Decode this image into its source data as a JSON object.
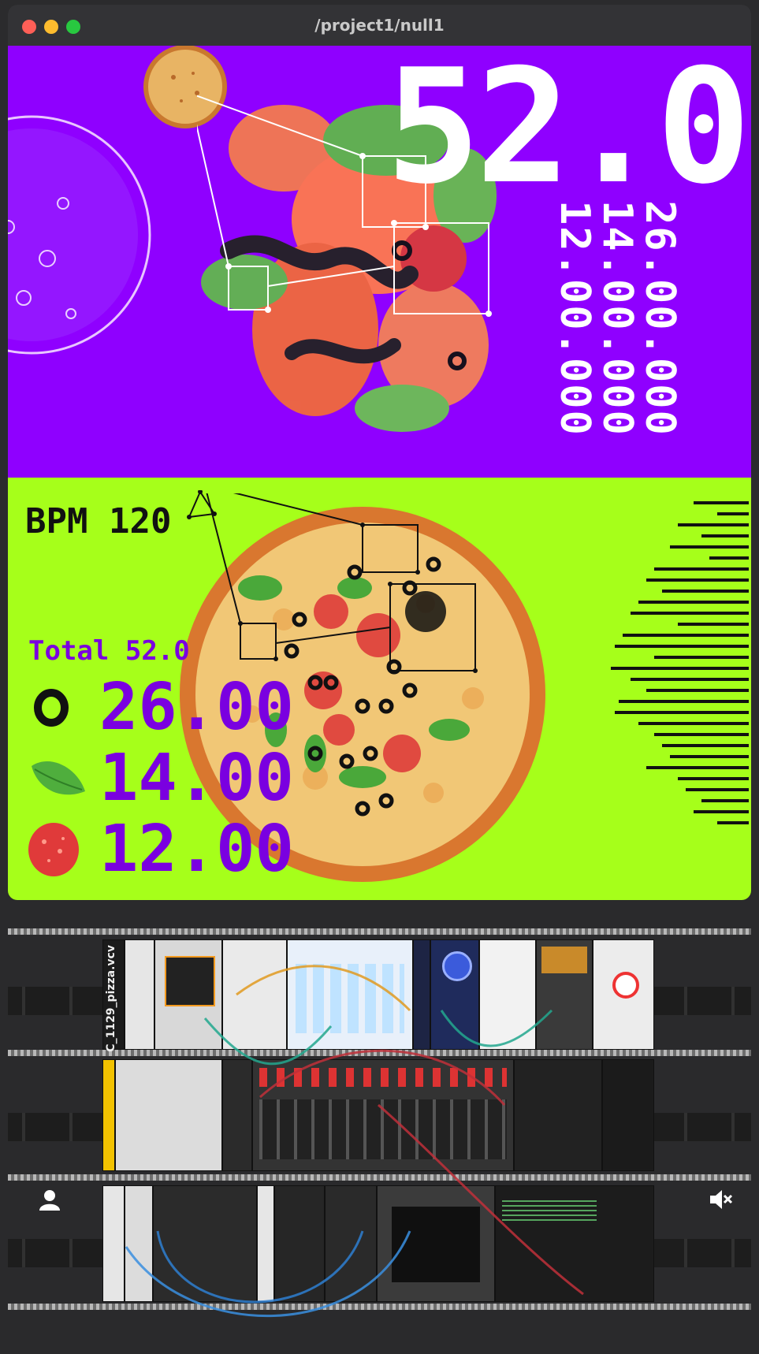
{
  "window": {
    "title": "/project1/null1"
  },
  "top_panel": {
    "big_value": "52.0",
    "counts": [
      "26.00.000",
      "14.00.000",
      "12.00.000"
    ]
  },
  "bottom_panel": {
    "bpm_label": "BPM",
    "bpm_value": "120",
    "total_label": "Total",
    "total_value": "52.0",
    "rows": [
      {
        "icon": "olive-icon",
        "value": "26.00.000"
      },
      {
        "icon": "basil-leaf-icon",
        "value": "14.00.000"
      },
      {
        "icon": "tomato-icon",
        "value": "12.00.000"
      }
    ]
  },
  "rack": {
    "patch_label": "C_1129_pizza.vcv",
    "footer_icons": [
      "user-icon",
      "speaker-muted-icon"
    ]
  },
  "colors": {
    "top_bg": "#8f00ff",
    "bottom_bg": "#a6ff1a",
    "value_purple": "#7a00e0"
  }
}
